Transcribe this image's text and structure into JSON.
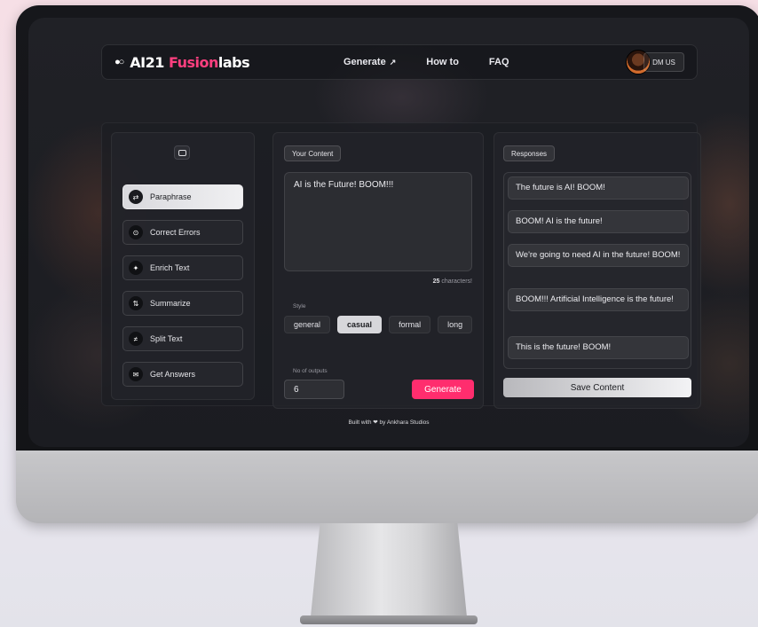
{
  "nav": {
    "logo_mark": "●○",
    "logo_ai": "AI21 ",
    "logo_fusion": "Fusion",
    "logo_labs": "labs",
    "links": [
      {
        "label": "Generate",
        "icon": "↗"
      },
      {
        "label": "How to"
      },
      {
        "label": "FAQ"
      }
    ],
    "dm_label": "DM US"
  },
  "sidebar": {
    "items": [
      {
        "label": "Paraphrase",
        "icon": "⇄",
        "active": true
      },
      {
        "label": "Correct Errors",
        "icon": "⊙"
      },
      {
        "label": "Enrich Text",
        "icon": "✦"
      },
      {
        "label": "Summarize",
        "icon": "⇅"
      },
      {
        "label": "Split Text",
        "icon": "≠"
      },
      {
        "label": "Get Answers",
        "icon": "✉"
      }
    ]
  },
  "content": {
    "heading": "Your Content",
    "text": "AI is the Future! BOOM!!!",
    "char_count": "25",
    "char_label": " characters!",
    "style_label": "Style",
    "styles": [
      "general",
      "casual",
      "formal",
      "long"
    ],
    "selected_style": "casual",
    "outputs_label": "No of outputs",
    "outputs_value": "6",
    "generate_label": "Generate"
  },
  "responses": {
    "heading": "Responses",
    "items": [
      "The future is AI! BOOM!",
      "BOOM! AI is the future!",
      "We're going to need AI in the future! BOOM!",
      "BOOM!!! Artificial Intelligence is the future!",
      "This is the future! BOOM!"
    ],
    "save_label": "Save Content"
  },
  "footer": "Built with ❤ by Ankhara Studios",
  "colors": {
    "accent": "#ff2d6e",
    "fusion": "#ff3f7f"
  }
}
